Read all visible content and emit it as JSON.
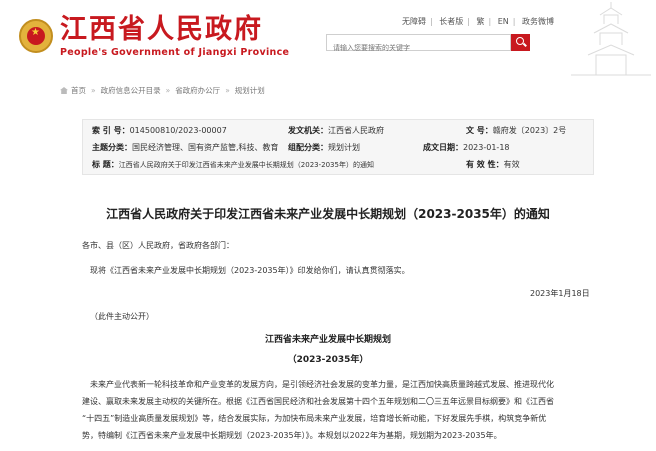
{
  "header": {
    "site_title": "江西省人民政府",
    "site_subtitle": "People's Government of Jiangxi Province",
    "top_links": [
      "无障碍",
      "长者版",
      "繁",
      "EN",
      "政务微博"
    ],
    "search_placeholder": "请输入您要搜索的关键字"
  },
  "breadcrumb": [
    "首页",
    "政府信息公开目录",
    "省政府办公厅",
    "规划计划"
  ],
  "info": {
    "index_key": "索 引 号：",
    "index_val": "014500810/2023-00007",
    "issuer_key": "发文机关：",
    "issuer_val": "江西省人民政府",
    "docno_key": "文  号：",
    "docno_val": "赣府发〔2023〕2号",
    "category_key": "主题分类：",
    "category_val": "国民经济管理、国有资产监管,科技、教育",
    "genre_key": "组配分类：",
    "genre_val": "规划计划",
    "date_key": "成文日期：",
    "date_val": "2023-01-18",
    "title_key": "标  题：",
    "title_val": "江西省人民政府关于印发江西省未来产业发展中长期规划（2023-2035年）的通知",
    "validity_key": "有 效 性：",
    "validity_val": "有效"
  },
  "doc": {
    "title": "江西省人民政府关于印发江西省未来产业发展中长期规划（2023-2035年）的通知",
    "salutation": "各市、县（区）人民政府，省政府各部门：",
    "body1": "现将《江西省未来产业发展中长期规划（2023-2035年）》印发给你们，请认真贯彻落实。",
    "sign_date": "2023年1月18日",
    "public_note": "（此件主动公开）",
    "plan_title": "江西省未来产业发展中长期规划",
    "plan_years": "（2023-2035年）",
    "lines": [
      "未来产业代表新一轮科技革命和产业变革的发展方向，是引领经济社会发展的变革力量，是江西加快高质量跨越式发展、推进现代化",
      "建设、赢取未来发展主动权的关键所在。根据《江西省国民经济和社会发展第十四个五年规划和二〇三五年远景目标纲要》和《江西省",
      "“十四五”制造业高质量发展规划》等，结合发展实际，为加快布局未来产业发展，培育增长新动能，下好发展先手棋，构筑竞争新优",
      "势，特编制《江西省未来产业发展中长期规划（2023-2035年）》。本规划以2022年为基期，规划期为2023-2035年。"
    ]
  }
}
